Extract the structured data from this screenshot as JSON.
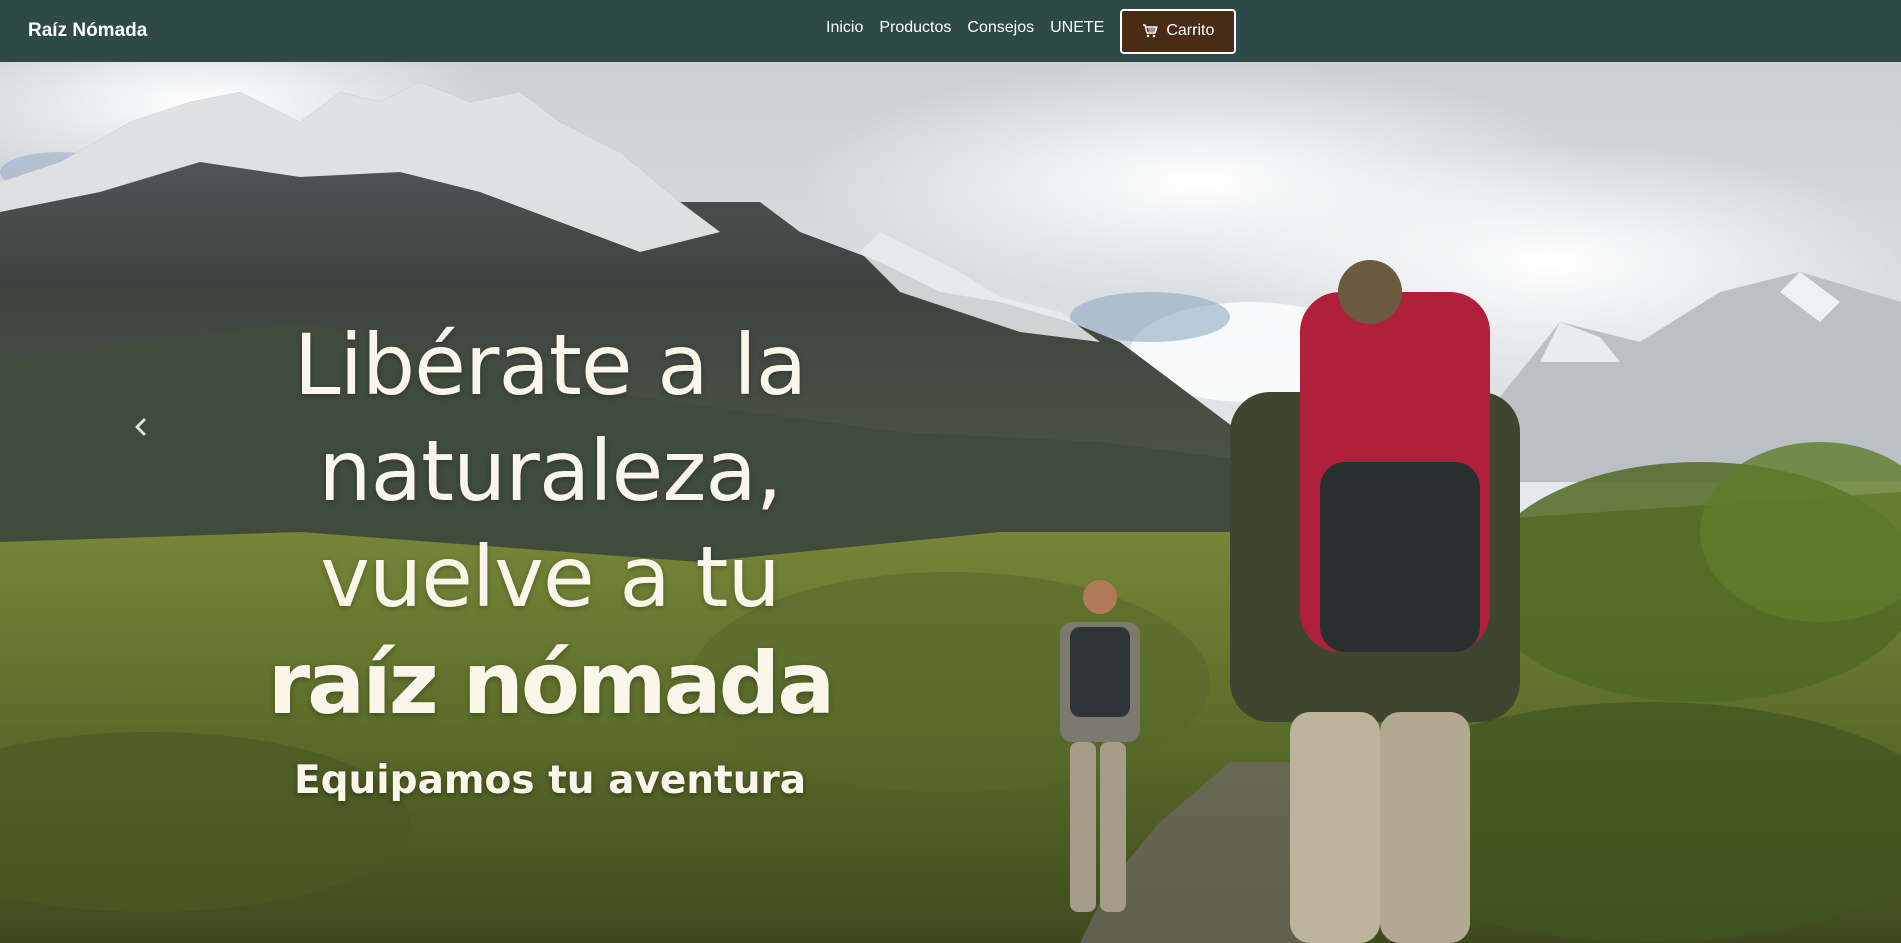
{
  "navbar": {
    "brand": "Raíz Nómada",
    "links": [
      "Inicio",
      "Productos",
      "Consejos",
      "UNETE"
    ],
    "cart_label": "Carrito",
    "background_color": "#2e4a48",
    "cart_color": "#4a2b16",
    "cart_icon": "cart-icon"
  },
  "hero": {
    "headline_lines": [
      "Libérate a la",
      "naturaleza,",
      "vuelve a tu"
    ],
    "headline_bold": "raíz nómada",
    "tagline": "Equipamos tu aventura",
    "text_color": "#fbf6ea",
    "prev_icon": "chevron-left-icon"
  }
}
